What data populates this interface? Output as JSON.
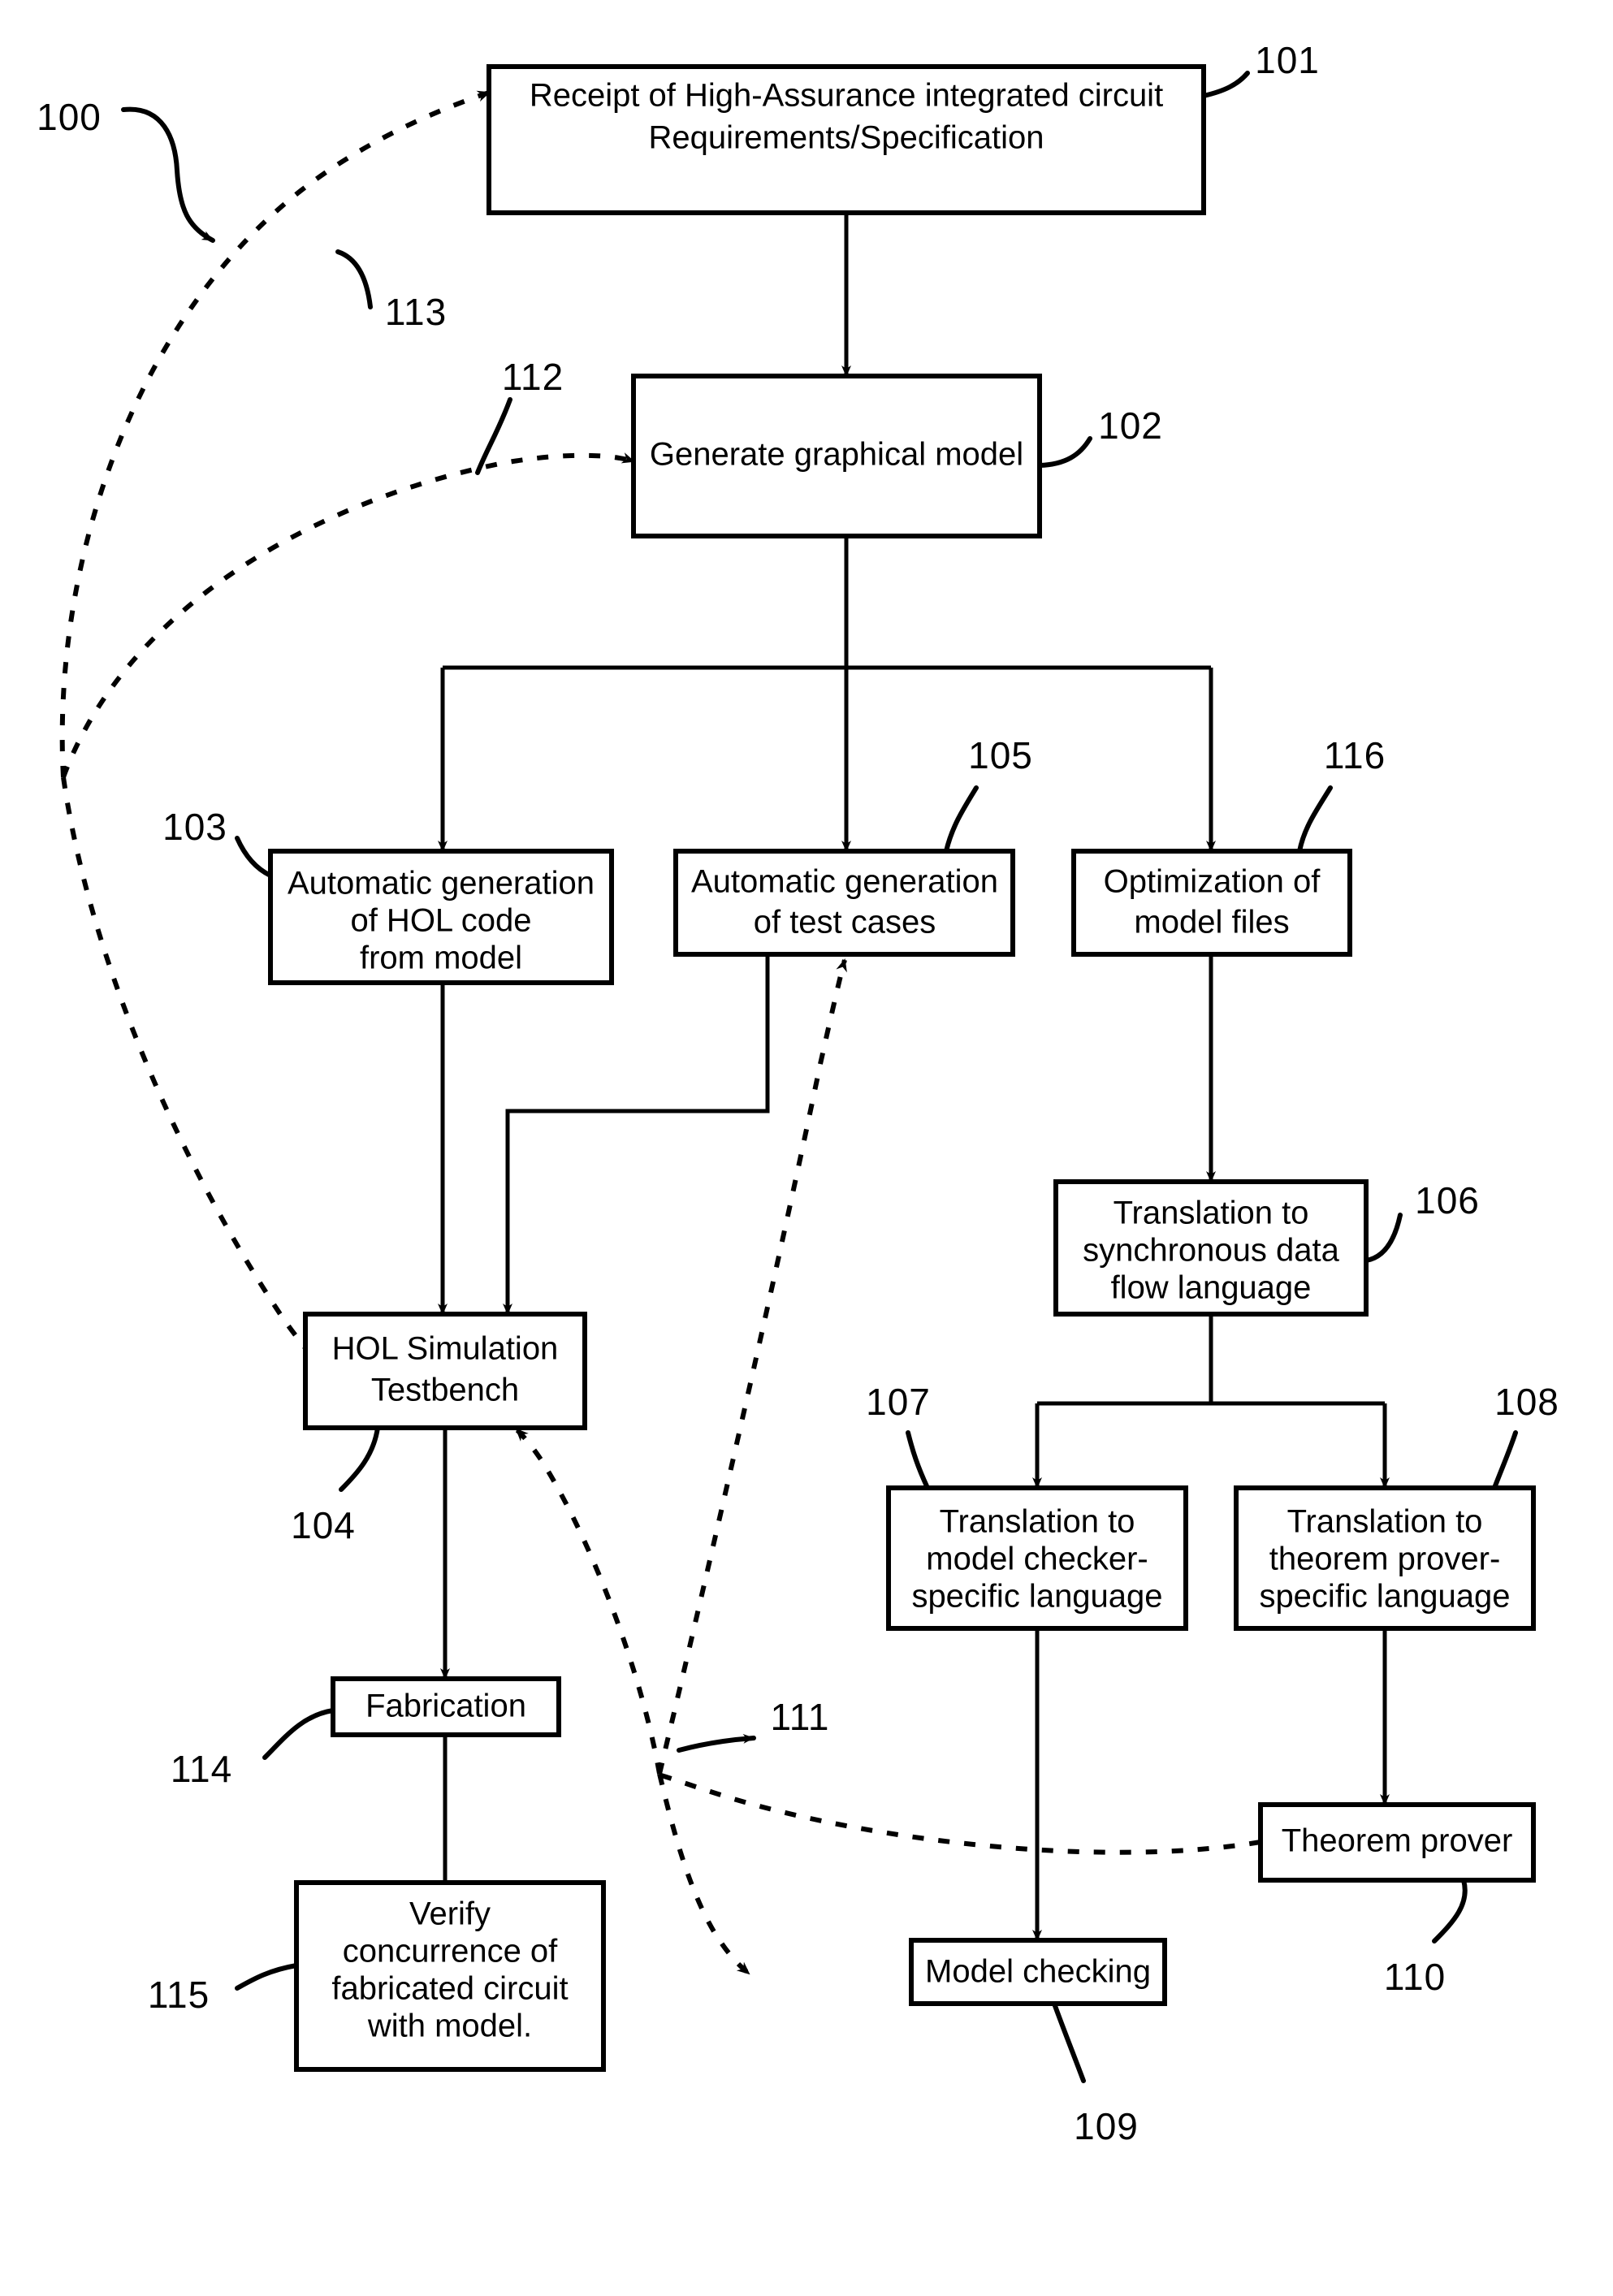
{
  "figure": {
    "title": "High-Assurance integrated circuit design and verification flowchart",
    "figure_label": "100",
    "stroke_color": "#000000",
    "background_color": "#ffffff"
  },
  "boxes": {
    "b101": {
      "ref": "101",
      "lines": [
        "Receipt of High-Assurance integrated circuit",
        "Requirements/Specification"
      ]
    },
    "b102": {
      "ref": "102",
      "lines": [
        "Generate graphical model"
      ]
    },
    "b103": {
      "ref": "103",
      "lines": [
        "Automatic generation",
        "of HOL code",
        "from model"
      ]
    },
    "b105": {
      "ref": "105",
      "lines": [
        "Automatic generation",
        "of test cases"
      ]
    },
    "b116": {
      "ref": "116",
      "lines": [
        "Optimization of",
        "model files"
      ]
    },
    "b106": {
      "ref": "106",
      "lines": [
        "Translation to",
        "synchronous data",
        "flow language"
      ]
    },
    "b107": {
      "ref": "107",
      "lines": [
        "Translation to",
        "model checker-",
        "specific language"
      ]
    },
    "b108": {
      "ref": "108",
      "lines": [
        "Translation to",
        "theorem prover-",
        "specific language"
      ]
    },
    "b104": {
      "ref": "104",
      "lines": [
        "HOL Simulation",
        "Testbench"
      ]
    },
    "b114": {
      "ref": "114",
      "lines": [
        "Fabrication"
      ]
    },
    "b115": {
      "ref": "115",
      "lines": [
        "Verify",
        "concurrence of",
        "fabricated circuit",
        "with model."
      ]
    },
    "b109": {
      "ref": "109",
      "lines": [
        "Model checking"
      ]
    },
    "b110": {
      "ref": "110",
      "lines": [
        "Theorem prover"
      ]
    }
  },
  "callouts": {
    "c100": "100",
    "c101": "101",
    "c102": "102",
    "c103": "103",
    "c104": "104",
    "c105": "105",
    "c106": "106",
    "c107": "107",
    "c108": "108",
    "c109": "109",
    "c110": "110",
    "c111": "111",
    "c112": "112",
    "c113": "113",
    "c114": "114",
    "c115": "115",
    "c116": "116"
  }
}
